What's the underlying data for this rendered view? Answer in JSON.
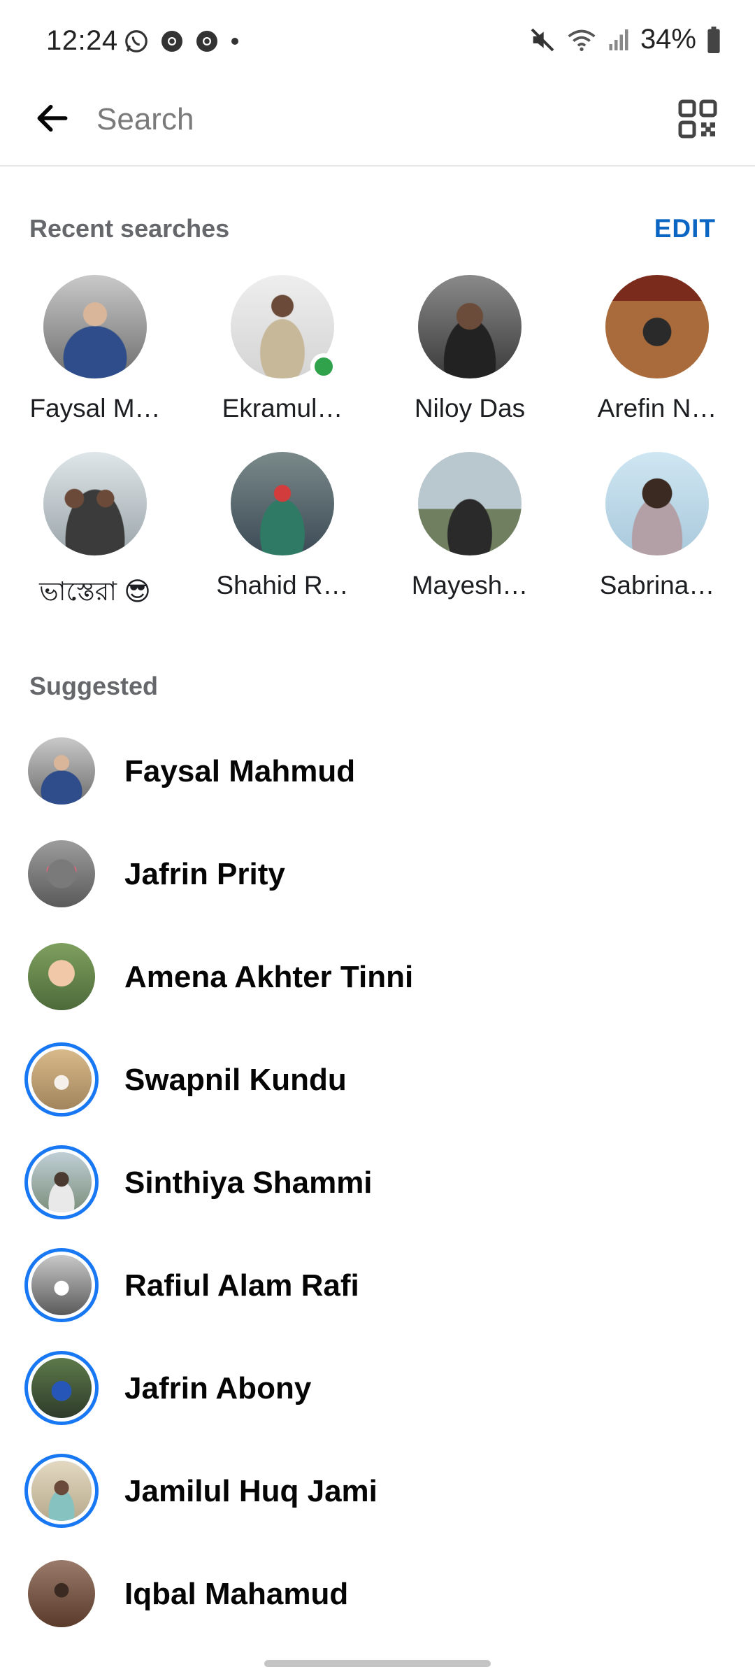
{
  "status_bar": {
    "time": "12:24",
    "battery": "34%",
    "left_icons": [
      "whatsapp-icon",
      "chrome-icon",
      "chrome-icon",
      "dot-icon"
    ],
    "right_icons": [
      "mute-icon",
      "wifi-icon",
      "signal-icon",
      "battery-icon"
    ]
  },
  "header": {
    "search_placeholder": "Search",
    "back_icon": "arrow-left-icon",
    "qr_icon": "qr-code-icon"
  },
  "recent": {
    "title": "Recent searches",
    "edit_label": "EDIT",
    "items": [
      {
        "name": "Faysal M…"
      },
      {
        "name": "Ekramul…",
        "online": true
      },
      {
        "name": "Niloy Das"
      },
      {
        "name": "Arefin N…"
      },
      {
        "name": "ভাস্তেরা 😎"
      },
      {
        "name": "Shahid R…"
      },
      {
        "name": "Mayesh…"
      },
      {
        "name": "Sabrina…"
      }
    ]
  },
  "suggested": {
    "title": "Suggested",
    "items": [
      {
        "name": "Faysal Mahmud",
        "story": false
      },
      {
        "name": "Jafrin Prity",
        "story": false
      },
      {
        "name": "Amena Akhter Tinni",
        "story": false
      },
      {
        "name": "Swapnil Kundu",
        "story": true
      },
      {
        "name": "Sinthiya Shammi",
        "story": true
      },
      {
        "name": "Rafiul Alam Rafi",
        "story": true
      },
      {
        "name": "Jafrin Abony",
        "story": true
      },
      {
        "name": "Jamilul Huq Jami",
        "story": true
      },
      {
        "name": "Iqbal Mahamud",
        "story": false
      }
    ]
  },
  "colors": {
    "accent": "#0a66c2",
    "story_ring": "#1877f2",
    "online": "#31a24c"
  }
}
